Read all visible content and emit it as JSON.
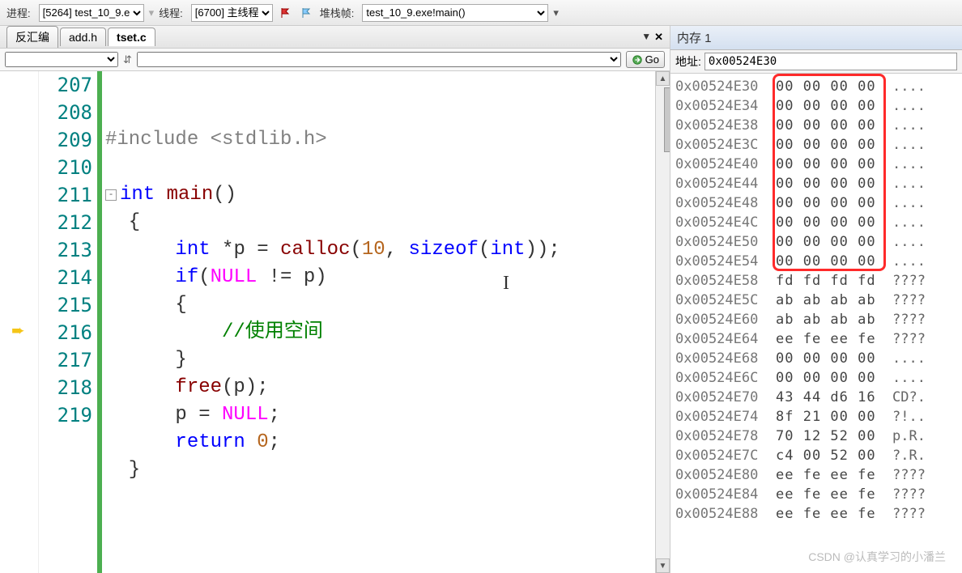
{
  "toolbar": {
    "process_label": "进程:",
    "process_value": "[5264] test_10_9.e",
    "thread_label": "线程:",
    "thread_value": "[6700] 主线程",
    "stack_label": "堆栈帧:",
    "stack_value": "test_10_9.exe!main()"
  },
  "tabs": [
    {
      "label": "反汇编",
      "active": false
    },
    {
      "label": "add.h",
      "active": false
    },
    {
      "label": "tset.c",
      "active": true
    }
  ],
  "editor_bar": {
    "go_label": "Go"
  },
  "code": {
    "lines": [
      {
        "n": 207,
        "tokens": [
          {
            "t": "#include ",
            "c": "incl"
          },
          {
            "t": "<stdlib.h>",
            "c": "incl"
          }
        ]
      },
      {
        "n": 208,
        "tokens": []
      },
      {
        "n": 209,
        "fold": "-",
        "tokens": [
          {
            "t": "int",
            "c": "type"
          },
          {
            "t": " main",
            "c": "fn"
          },
          {
            "t": "()",
            "c": ""
          }
        ]
      },
      {
        "n": 210,
        "tokens": [
          {
            "t": "  {",
            "c": ""
          }
        ]
      },
      {
        "n": 211,
        "tokens": [
          {
            "t": "      ",
            "c": ""
          },
          {
            "t": "int",
            "c": "type"
          },
          {
            "t": " *p = ",
            "c": ""
          },
          {
            "t": "calloc",
            "c": "fn"
          },
          {
            "t": "(",
            "c": ""
          },
          {
            "t": "10",
            "c": "num"
          },
          {
            "t": ", ",
            "c": ""
          },
          {
            "t": "sizeof",
            "c": "kw"
          },
          {
            "t": "(",
            "c": ""
          },
          {
            "t": "int",
            "c": "type"
          },
          {
            "t": "));",
            "c": ""
          }
        ]
      },
      {
        "n": 212,
        "tokens": [
          {
            "t": "      ",
            "c": ""
          },
          {
            "t": "if",
            "c": "kw"
          },
          {
            "t": "(",
            "c": ""
          },
          {
            "t": "NULL",
            "c": "const"
          },
          {
            "t": " != p)",
            "c": ""
          }
        ]
      },
      {
        "n": 213,
        "tokens": [
          {
            "t": "      {",
            "c": ""
          }
        ]
      },
      {
        "n": 214,
        "tokens": [
          {
            "t": "          ",
            "c": ""
          },
          {
            "t": "//使用空间",
            "c": "comment"
          }
        ]
      },
      {
        "n": 215,
        "tokens": [
          {
            "t": "      }",
            "c": ""
          }
        ]
      },
      {
        "n": 216,
        "arrow": true,
        "tokens": [
          {
            "t": "      free(p);",
            "c": "fn2",
            "raw": true
          }
        ]
      },
      {
        "n": 217,
        "tokens": [
          {
            "t": "      p = ",
            "c": ""
          },
          {
            "t": "NULL",
            "c": "const"
          },
          {
            "t": ";",
            "c": ""
          }
        ]
      },
      {
        "n": 218,
        "tokens": [
          {
            "t": "      ",
            "c": ""
          },
          {
            "t": "return",
            "c": "kw"
          },
          {
            "t": " ",
            "c": ""
          },
          {
            "t": "0",
            "c": "num"
          },
          {
            "t": ";",
            "c": ""
          }
        ]
      },
      {
        "n": 219,
        "tokens": [
          {
            "t": "  }",
            "c": ""
          }
        ]
      }
    ]
  },
  "memory": {
    "title": "内存 1",
    "address_label": "地址:",
    "address_value": "0x00524E30",
    "rows": [
      {
        "addr": "0x00524E30",
        "hex": "00 00 00 00",
        "asc": "....",
        "hl": true
      },
      {
        "addr": "0x00524E34",
        "hex": "00 00 00 00",
        "asc": "....",
        "hl": true
      },
      {
        "addr": "0x00524E38",
        "hex": "00 00 00 00",
        "asc": "....",
        "hl": true
      },
      {
        "addr": "0x00524E3C",
        "hex": "00 00 00 00",
        "asc": "....",
        "hl": true
      },
      {
        "addr": "0x00524E40",
        "hex": "00 00 00 00",
        "asc": "....",
        "hl": true
      },
      {
        "addr": "0x00524E44",
        "hex": "00 00 00 00",
        "asc": "....",
        "hl": true
      },
      {
        "addr": "0x00524E48",
        "hex": "00 00 00 00",
        "asc": "....",
        "hl": true
      },
      {
        "addr": "0x00524E4C",
        "hex": "00 00 00 00",
        "asc": "....",
        "hl": true
      },
      {
        "addr": "0x00524E50",
        "hex": "00 00 00 00",
        "asc": "....",
        "hl": true
      },
      {
        "addr": "0x00524E54",
        "hex": "00 00 00 00",
        "asc": "....",
        "hl": true
      },
      {
        "addr": "0x00524E58",
        "hex": "fd fd fd fd",
        "asc": "????"
      },
      {
        "addr": "0x00524E5C",
        "hex": "ab ab ab ab",
        "asc": "????"
      },
      {
        "addr": "0x00524E60",
        "hex": "ab ab ab ab",
        "asc": "????"
      },
      {
        "addr": "0x00524E64",
        "hex": "ee fe ee fe",
        "asc": "????"
      },
      {
        "addr": "0x00524E68",
        "hex": "00 00 00 00",
        "asc": "...."
      },
      {
        "addr": "0x00524E6C",
        "hex": "00 00 00 00",
        "asc": "...."
      },
      {
        "addr": "0x00524E70",
        "hex": "43 44 d6 16",
        "asc": "CD?."
      },
      {
        "addr": "0x00524E74",
        "hex": "8f 21 00 00",
        "asc": "?!.."
      },
      {
        "addr": "0x00524E78",
        "hex": "70 12 52 00",
        "asc": "p.R."
      },
      {
        "addr": "0x00524E7C",
        "hex": "c4 00 52 00",
        "asc": "?.R."
      },
      {
        "addr": "0x00524E80",
        "hex": "ee fe ee fe",
        "asc": "????"
      },
      {
        "addr": "0x00524E84",
        "hex": "ee fe ee fe",
        "asc": "????"
      },
      {
        "addr": "0x00524E88",
        "hex": "ee fe ee fe",
        "asc": "????"
      }
    ]
  },
  "watermark": "CSDN @认真学习的小潘兰"
}
